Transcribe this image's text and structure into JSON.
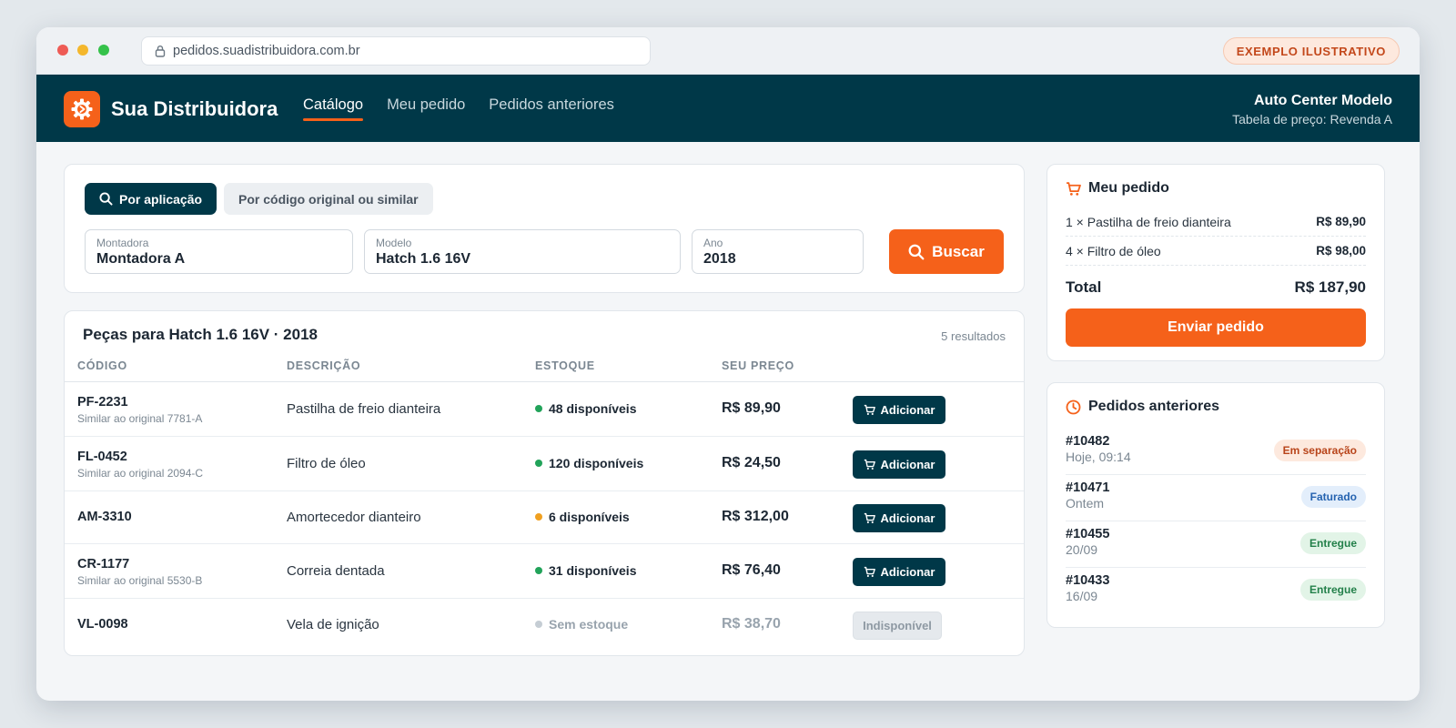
{
  "browser": {
    "url": "pedidos.suadistribuidora.com.br",
    "example_badge": "EXEMPLO ILUSTRATIVO"
  },
  "header": {
    "brand": "Sua Distribuidora",
    "nav": [
      {
        "label": "Catálogo",
        "active": true
      },
      {
        "label": "Meu pedido",
        "active": false
      },
      {
        "label": "Pedidos anteriores",
        "active": false
      }
    ],
    "account_name": "Auto Center Modelo",
    "price_table": "Tabela de preço: Revenda A"
  },
  "search": {
    "tabs": [
      {
        "label": "Por aplicação",
        "active": true
      },
      {
        "label": "Por código original ou similar",
        "active": false
      }
    ],
    "fields": [
      {
        "label": "Montadora",
        "value": "Montadora A"
      },
      {
        "label": "Modelo",
        "value": "Hatch 1.6 16V"
      },
      {
        "label": "Ano",
        "value": "2018"
      }
    ],
    "button": "Buscar"
  },
  "results": {
    "title": "Peças para Hatch 1.6 16V · 2018",
    "count": "5 resultados",
    "columns": [
      "CÓDIGO",
      "DESCRIÇÃO",
      "ESTOQUE",
      "SEU PREÇO"
    ],
    "rows": [
      {
        "code": "PF-2231",
        "similar": "Similar ao original 7781-A",
        "desc": "Pastilha de freio dianteira",
        "stock": "48 disponíveis",
        "stock_status": "green",
        "price": "R$ 89,90",
        "action": "Adicionar"
      },
      {
        "code": "FL-0452",
        "similar": "Similar ao original 2094-C",
        "desc": "Filtro de óleo",
        "stock": "120 disponíveis",
        "stock_status": "green",
        "price": "R$ 24,50",
        "action": "Adicionar"
      },
      {
        "code": "AM-3310",
        "similar": "",
        "desc": "Amortecedor dianteiro",
        "stock": "6 disponíveis",
        "stock_status": "amber",
        "price": "R$ 312,00",
        "action": "Adicionar"
      },
      {
        "code": "CR-1177",
        "similar": "Similar ao original 5530-B",
        "desc": "Correia dentada",
        "stock": "31 disponíveis",
        "stock_status": "green",
        "price": "R$ 76,40",
        "action": "Adicionar"
      },
      {
        "code": "VL-0098",
        "similar": "",
        "desc": "Vela de ignição",
        "stock": "Sem estoque",
        "stock_status": "gray",
        "price": "R$ 38,70",
        "action": "Indisponível"
      }
    ]
  },
  "order": {
    "title": "Meu pedido",
    "items": [
      {
        "name": "1 × Pastilha de freio dianteira",
        "value": "R$ 89,90"
      },
      {
        "name": "4 × Filtro de óleo",
        "value": "R$ 98,00"
      }
    ],
    "total_label": "Total",
    "total_value": "R$ 187,90",
    "send_button": "Enviar pedido"
  },
  "history": {
    "title": "Pedidos anteriores",
    "orders": [
      {
        "id": "#10482",
        "date": "Hoje, 09:14",
        "status": "Em separação",
        "kind": "sep"
      },
      {
        "id": "#10471",
        "date": "Ontem",
        "status": "Faturado",
        "kind": "fat"
      },
      {
        "id": "#10455",
        "date": "20/09",
        "status": "Entregue",
        "kind": "ent"
      },
      {
        "id": "#10433",
        "date": "16/09",
        "status": "Entregue",
        "kind": "ent"
      }
    ]
  },
  "colors": {
    "primary": "#003848",
    "accent": "#f5611a",
    "stock_green": "#22a35a",
    "stock_amber": "#f0a020",
    "stock_gray": "#c5cdd4"
  }
}
